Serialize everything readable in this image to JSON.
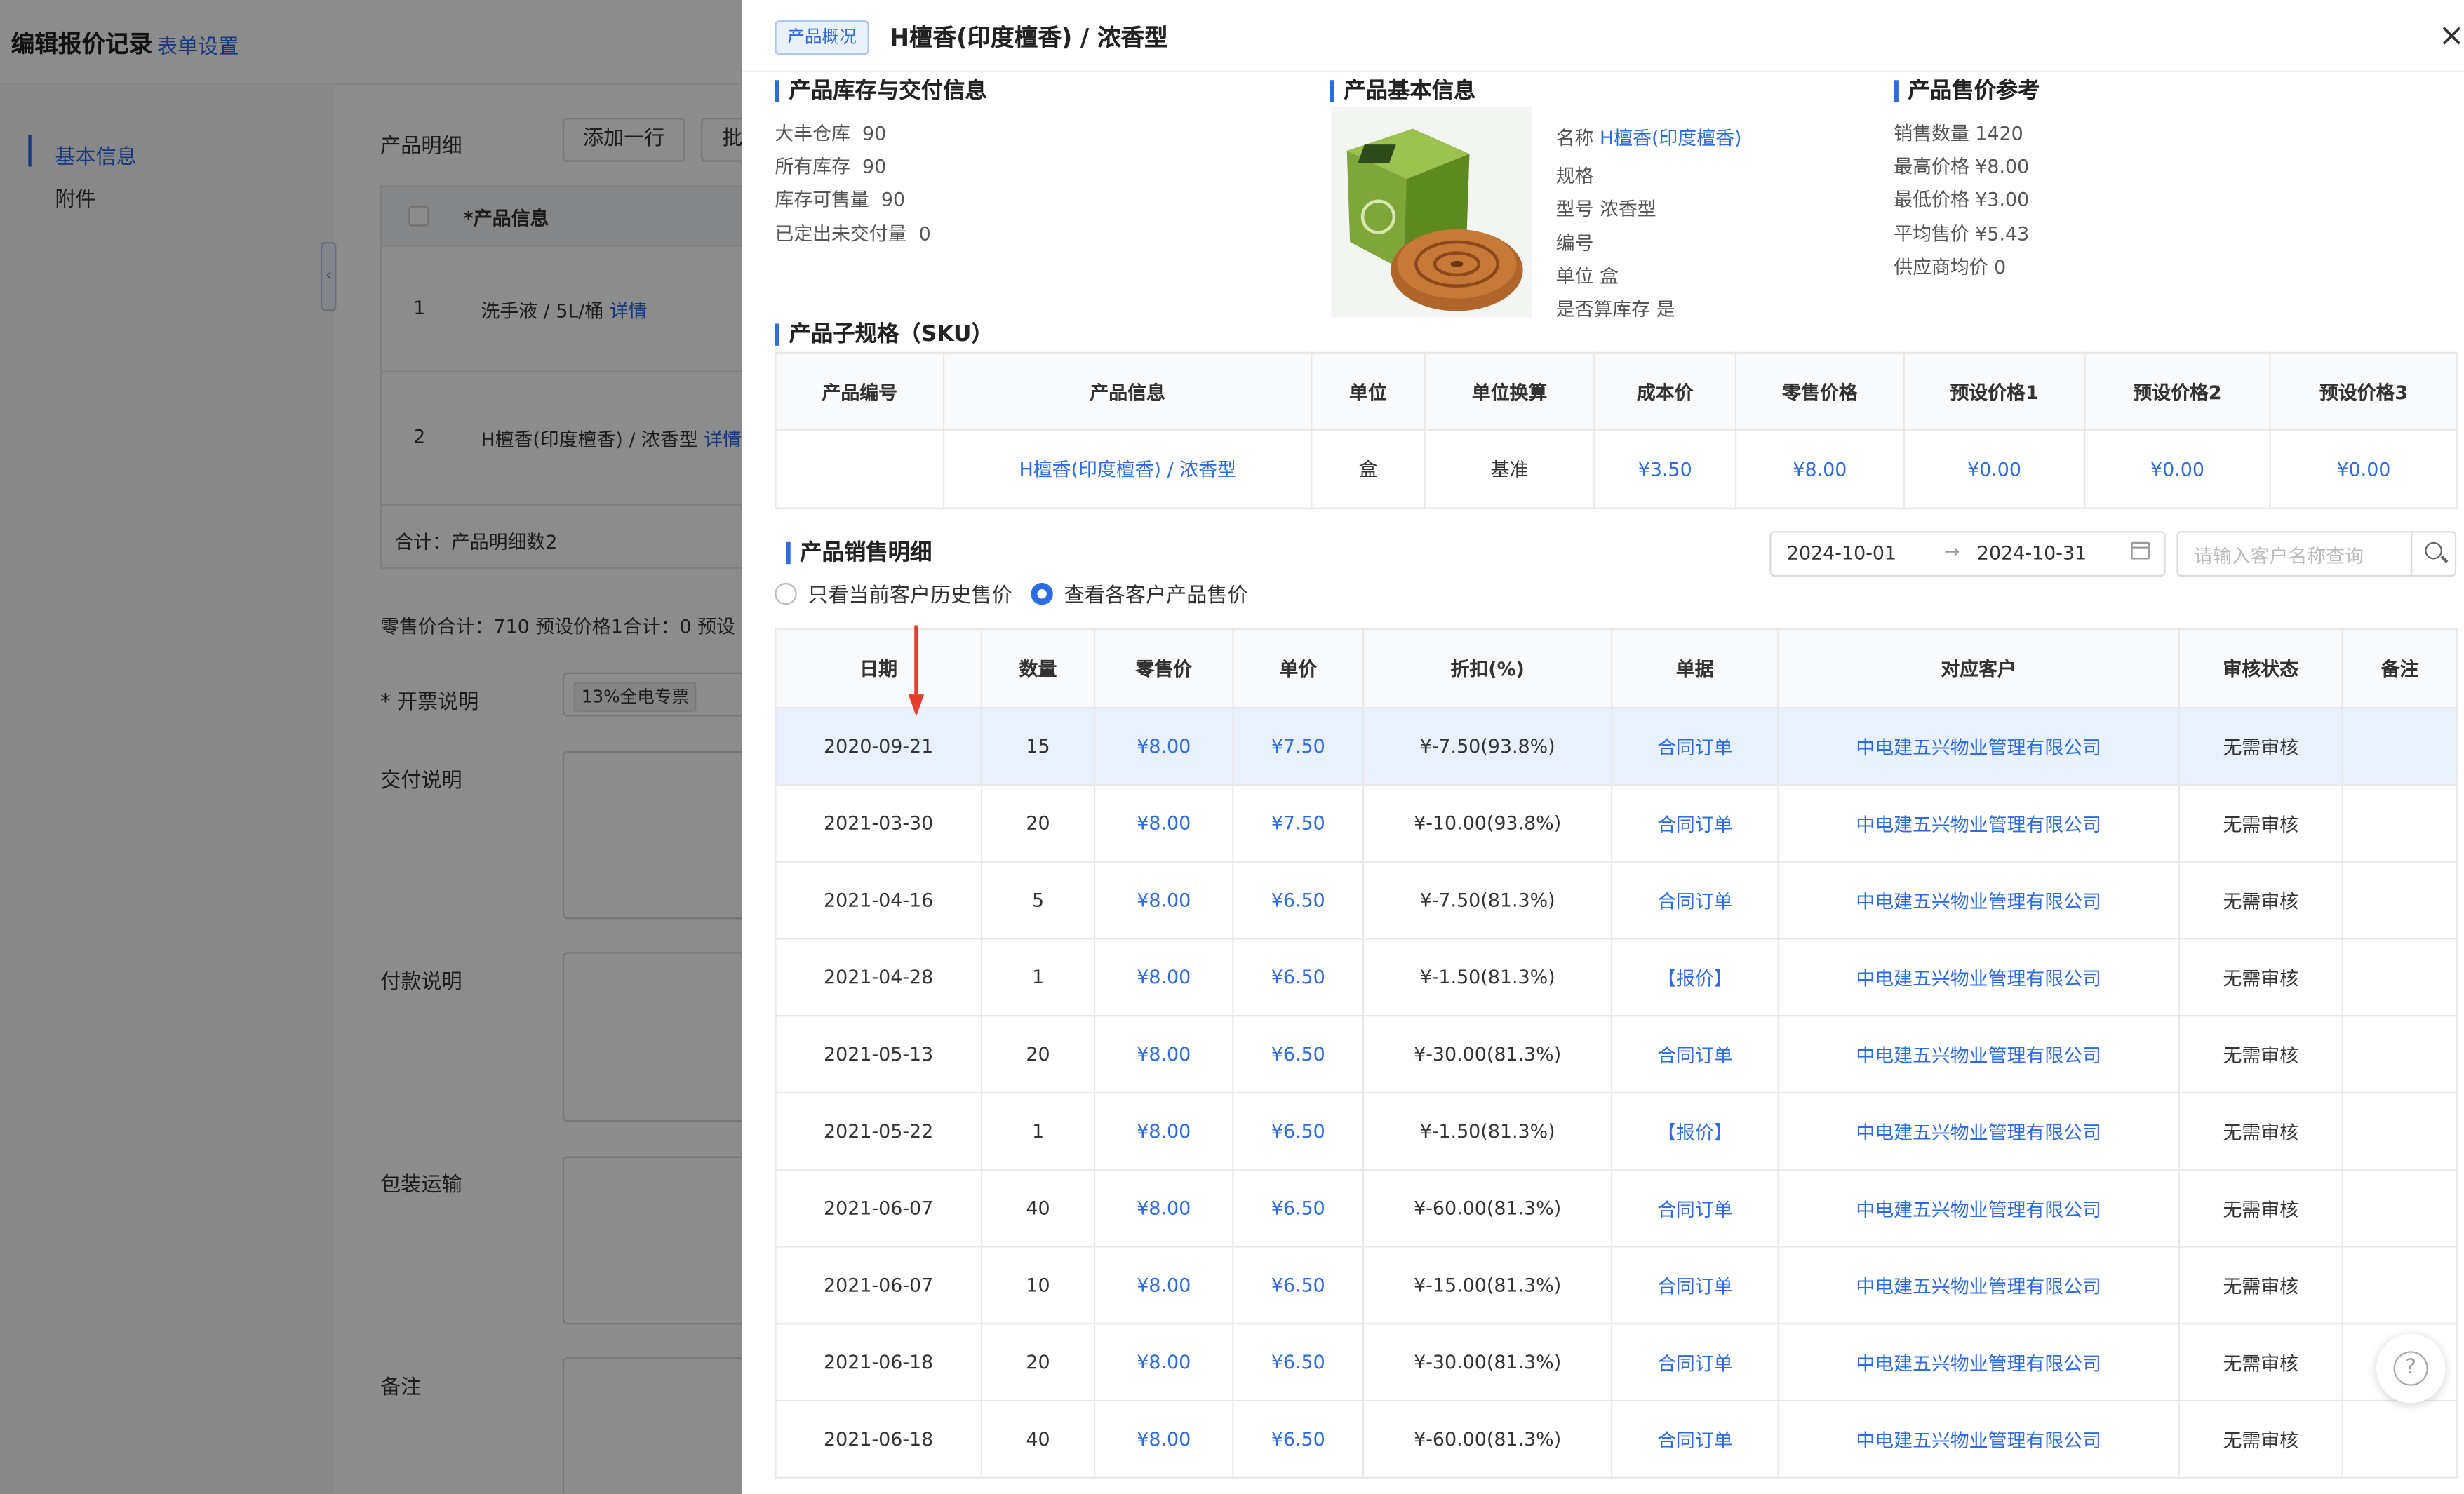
{
  "background": {
    "page_title": "编辑报价记录",
    "form_settings_link": "表单设置",
    "nav": [
      "基本信息",
      "附件"
    ],
    "product_detail_label": "产品明细",
    "add_row_button": "添加一行",
    "batch_button_partial": "批",
    "product_info_header": "*产品信息",
    "rows": [
      {
        "index": "1",
        "name": "洗手液 / 5L/桶",
        "link": "详情"
      },
      {
        "index": "2",
        "name": "H檀香(印度檀香) / 浓香型",
        "link": "详情"
      }
    ],
    "total_text": "合计：产品明细数2",
    "summary_text": "零售价合计：710   预设价格1合计：0   预设",
    "invoice_label": "* 开票说明",
    "invoice_tag": "13%全电专票",
    "delivery_label": "交付说明",
    "payment_label": "付款说明",
    "packing_label": "包装运输",
    "remark_label": "备注"
  },
  "panel": {
    "tag": "产品概况",
    "title": "H檀香(印度檀香) / 浓香型",
    "close_icon": "×",
    "inventory": {
      "title": "产品库存与交付信息",
      "items": [
        {
          "label": "大丰仓库",
          "value": "90"
        },
        {
          "label": "所有库存",
          "value": "90"
        },
        {
          "label": "库存可售量",
          "value": "90"
        },
        {
          "label": "已定出未交付量",
          "value": "0"
        }
      ]
    },
    "basic": {
      "title": "产品基本信息",
      "name_label": "名称",
      "name_value": "H檀香(印度檀香)",
      "spec_label": "规格",
      "model_label": "型号",
      "model_value": "浓香型",
      "code_label": "编号",
      "unit_label": "单位",
      "unit_value": "盒",
      "stock_calc_label": "是否算库存",
      "stock_calc_value": "是"
    },
    "price_ref": {
      "title": "产品售价参考",
      "items": [
        "销售数量 1420",
        "最高价格 ¥8.00",
        "最低价格 ¥3.00",
        "平均售价 ¥5.43",
        "供应商均价 0"
      ]
    },
    "sku": {
      "title": "产品子规格（SKU）",
      "headers": [
        "产品编号",
        "产品信息",
        "单位",
        "单位换算",
        "成本价",
        "零售价格",
        "预设价格1",
        "预设价格2",
        "预设价格3"
      ],
      "row": [
        "",
        "H檀香(印度檀香) / 浓香型",
        "盒",
        "基准",
        "¥3.50",
        "¥8.00",
        "¥0.00",
        "¥0.00",
        "¥0.00"
      ]
    },
    "sales": {
      "title": "产品销售明细",
      "date_start": "2024-10-01",
      "date_end": "2024-10-31",
      "date_arrow": "→",
      "search_placeholder": "请输入客户名称查询",
      "radio_current": "只看当前客户历史售价",
      "radio_all": "查看各客户产品售价",
      "headers": [
        "日期",
        "数量",
        "零售价",
        "单价",
        "折扣(%)",
        "单据",
        "对应客户",
        "审核状态",
        "备注"
      ],
      "rows": [
        [
          "2020-09-21",
          "15",
          "¥8.00",
          "¥7.50",
          "¥-7.50(93.8%)",
          "合同订单",
          "中电建五兴物业管理有限公司",
          "无需审核",
          ""
        ],
        [
          "2021-03-30",
          "20",
          "¥8.00",
          "¥7.50",
          "¥-10.00(93.8%)",
          "合同订单",
          "中电建五兴物业管理有限公司",
          "无需审核",
          ""
        ],
        [
          "2021-04-16",
          "5",
          "¥8.00",
          "¥6.50",
          "¥-7.50(81.3%)",
          "合同订单",
          "中电建五兴物业管理有限公司",
          "无需审核",
          ""
        ],
        [
          "2021-04-28",
          "1",
          "¥8.00",
          "¥6.50",
          "¥-1.50(81.3%)",
          "【报价】",
          "中电建五兴物业管理有限公司",
          "无需审核",
          ""
        ],
        [
          "2021-05-13",
          "20",
          "¥8.00",
          "¥6.50",
          "¥-30.00(81.3%)",
          "合同订单",
          "中电建五兴物业管理有限公司",
          "无需审核",
          ""
        ],
        [
          "2021-05-22",
          "1",
          "¥8.00",
          "¥6.50",
          "¥-1.50(81.3%)",
          "【报价】",
          "中电建五兴物业管理有限公司",
          "无需审核",
          ""
        ],
        [
          "2021-06-07",
          "40",
          "¥8.00",
          "¥6.50",
          "¥-60.00(81.3%)",
          "合同订单",
          "中电建五兴物业管理有限公司",
          "无需审核",
          ""
        ],
        [
          "2021-06-07",
          "10",
          "¥8.00",
          "¥6.50",
          "¥-15.00(81.3%)",
          "合同订单",
          "中电建五兴物业管理有限公司",
          "无需审核",
          ""
        ],
        [
          "2021-06-18",
          "20",
          "¥8.00",
          "¥6.50",
          "¥-30.00(81.3%)",
          "合同订单",
          "中电建五兴物业管理有限公司",
          "无需审核",
          ""
        ],
        [
          "2021-06-18",
          "40",
          "¥8.00",
          "¥6.50",
          "¥-60.00(81.3%)",
          "合同订单",
          "中电建五兴物业管理有限公司",
          "无需审核",
          ""
        ]
      ]
    }
  },
  "colors": {
    "accent": "#2b6be6",
    "highlight_row": "#e8f1fd",
    "annotation_arrow": "#e53d2f"
  },
  "icons": {
    "close": "close-icon",
    "calendar": "calendar-icon",
    "search": "search-icon",
    "help": "help-icon"
  }
}
